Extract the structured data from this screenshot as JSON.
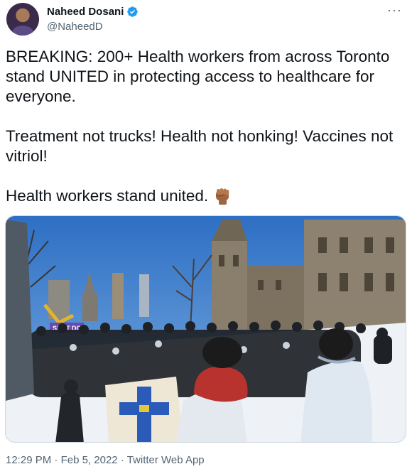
{
  "tweet": {
    "author_name": "Naheed Dosani",
    "handle": "@NaheedD",
    "more_label": "···",
    "body": "BREAKING: 200+ Health workers from across Toronto stand UNITED in protecting access to healthcare for everyone.\n\nTreatment not trucks! Health not honking! Vaccines not vitriol!\n\nHealth workers stand united.",
    "emoji_icon": "raised-fist-icon",
    "photo_sign_text": "SHUT DO",
    "time": "12:29 PM",
    "separator": " · ",
    "date": "Feb 5, 2022",
    "source": "Twitter Web App"
  },
  "colors": {
    "verified": "#1d9bf0",
    "meta_text": "#536471",
    "sky": "#3f7ec9"
  }
}
